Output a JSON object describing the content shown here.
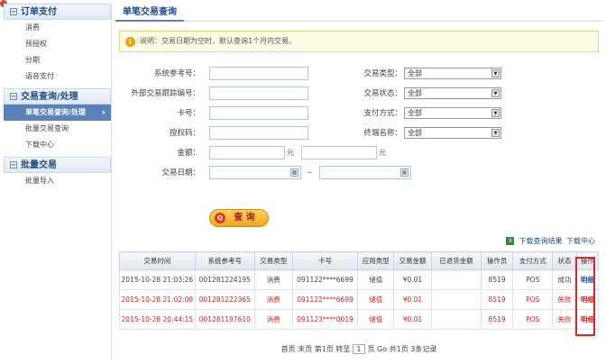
{
  "sidebar": {
    "groups": [
      {
        "title": "订单支付",
        "items": [
          "消费",
          "预授权",
          "分期",
          "语音支付"
        ]
      },
      {
        "title": "交易查询/处理",
        "items": [
          "单笔交易查询/处理",
          "批量交易查询",
          "下载中心"
        ]
      },
      {
        "title": "批量交易",
        "items": [
          "批量导入"
        ]
      }
    ],
    "active_item": "单笔交易查询/处理"
  },
  "page": {
    "title": "单笔交易查询",
    "notice": "说明：交易日期为空时，默认查询1个月内交易。"
  },
  "form": {
    "left": [
      {
        "label": "系统参考号：",
        "value": ""
      },
      {
        "label": "外部交易跟踪编号：",
        "value": ""
      },
      {
        "label": "卡号：",
        "value": ""
      },
      {
        "label": "授权码：",
        "value": ""
      }
    ],
    "right": [
      {
        "label": "交易类型：",
        "value": "全部"
      },
      {
        "label": "交易状态：",
        "value": "全部"
      },
      {
        "label": "支付方式：",
        "value": "全部"
      },
      {
        "label": "终端名称：",
        "value": "全部"
      }
    ],
    "amount_label": "金额：",
    "amount_unit": "元",
    "date_label": "交易日期：",
    "tilde": "~",
    "query_button": "查 询"
  },
  "downloads": {
    "link1": "下载查询结果",
    "link2": "下载中心"
  },
  "table": {
    "headers": [
      "交易时间",
      "系统参考号",
      "交易类型",
      "卡号",
      "应用类型",
      "交易金额",
      "已退货金额",
      "操作员",
      "支付方式",
      "状态",
      "操作"
    ],
    "rows": [
      [
        "2015-10-28 21:03:26",
        "001281224195",
        "消费",
        "091122****6699",
        "储值",
        "¥0.01",
        "",
        "8519",
        "POS",
        "成功",
        "明细"
      ],
      [
        "2015-10-28 21:02:08",
        "001281222365",
        "消费",
        "091122****6699",
        "储值",
        "¥0.01",
        "",
        "8519",
        "POS",
        "失败",
        "明细"
      ],
      [
        "2015-10-28 20:44:15",
        "001281197610",
        "消费",
        "091123****0019",
        "储值",
        "¥0.01",
        "",
        "8519",
        "POS",
        "失败",
        "明细"
      ]
    ]
  },
  "pager": {
    "text_before": "首页 末页 第1页 转至",
    "page_input": "1",
    "text_after": "页 Go 共1页 3条记录"
  },
  "colors": {
    "accent": "#1b4c85",
    "failed_row": "#d42424",
    "highlight_box": "#d8242a",
    "button": "#f2a51b"
  }
}
